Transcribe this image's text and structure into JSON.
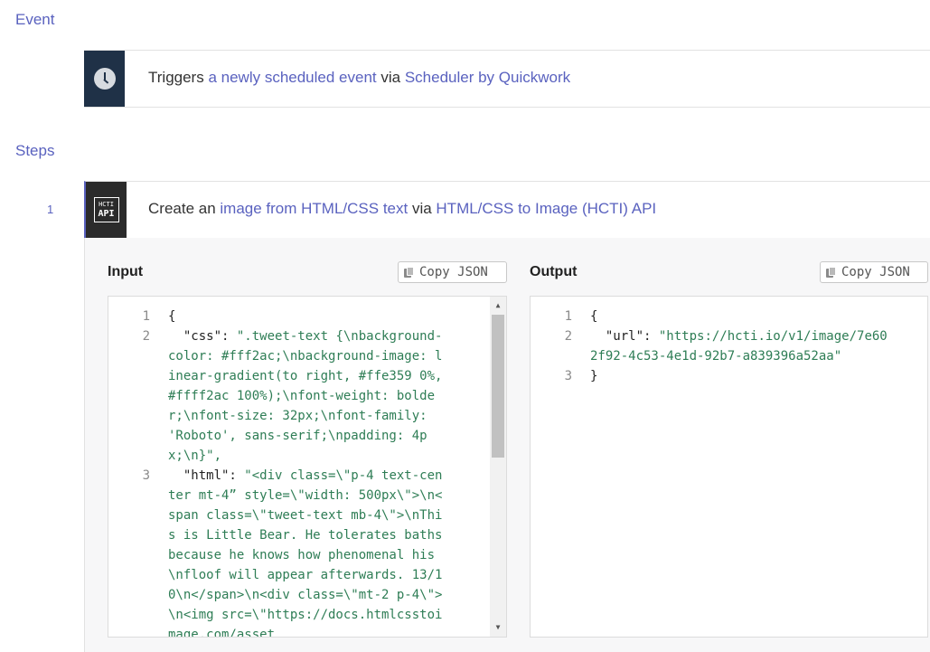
{
  "event_section": {
    "label": "Event",
    "row": {
      "prefix": "Triggers ",
      "trigger_link": "a newly scheduled event",
      "via": " via ",
      "app_link": "Scheduler by Quickwork"
    }
  },
  "steps_section": {
    "label": "Steps",
    "steps": [
      {
        "number": "1",
        "icon_line1": "HCTI",
        "icon_line2": "API",
        "prefix": "Create an ",
        "action_link": "image from HTML/CSS text",
        "via": " via ",
        "app_link": "HTML/CSS to Image (HCTI) API"
      }
    ]
  },
  "input_panel": {
    "title": "Input",
    "copy_label": "Copy JSON",
    "lines": [
      {
        "num": "1",
        "key": "{",
        "value": ""
      },
      {
        "num": "2",
        "key": "  \"css\": ",
        "value": "\".tweet-text {\\nbackground-color: #fff2ac;\\nbackground-image: linear-gradient(to right, #ffe359 0%, #ffff2ac 100%);\\nfont-weight: bolder;\\nfont-size: 32px;\\nfont-family: 'Roboto', sans-serif;\\npadding: 4px;\\n}\","
      },
      {
        "num": "3",
        "key": "  \"html\": ",
        "value": "\"<div class=\\\"p-4 text-center mt-4” style=\\\"width: 500px\\\">\\n<span class=\\\"tweet-text mb-4\\\">\\nThis is Little Bear. He tolerates baths because he knows how phenomenal his\\nfloof will appear afterwards. 13/10\\n</span>\\n<div class=\\\"mt-2 p-4\\\">\\n<img src=\\\"https://docs.htmlcsstoimage.com/asset"
      }
    ]
  },
  "output_panel": {
    "title": "Output",
    "copy_label": "Copy JSON",
    "lines": [
      {
        "num": "1",
        "key": "{",
        "value": ""
      },
      {
        "num": "2",
        "key": "  \"url\": ",
        "value": "\"https://hcti.io/v1/image/7e602f92-4c53-4e1d-92b7-a839396a52aa\""
      },
      {
        "num": "3",
        "key": "}",
        "value": ""
      }
    ]
  },
  "colors": {
    "accent": "#5a62bf",
    "string": "#2e7d55",
    "event_tile": "#1f3147",
    "step_tile": "#2b2b2b"
  },
  "icons": {
    "event": "clock-icon",
    "step": "hcti-api-icon",
    "copy": "copy-icon"
  }
}
